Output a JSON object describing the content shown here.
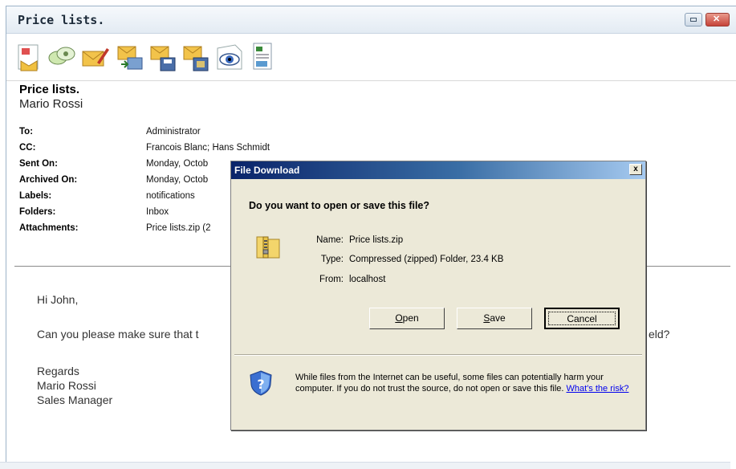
{
  "window": {
    "title": "Price lists."
  },
  "toolbar": {
    "buttons": [
      "reply-icon",
      "forward-discussion-icon",
      "compose-icon",
      "export-icon",
      "save-email-icon",
      "save-attachments-icon",
      "preview-icon",
      "view-details-icon"
    ]
  },
  "email": {
    "subject": "Price lists.",
    "sender": "Mario Rossi",
    "fields": [
      {
        "label": "To:",
        "value": "Administrator"
      },
      {
        "label": "CC:",
        "value": "Francois Blanc; Hans Schmidt"
      },
      {
        "label": "Sent On:",
        "value": "Monday, Octob"
      },
      {
        "label": "Archived On:",
        "value": "Monday, Octob"
      },
      {
        "label": "Labels:",
        "value": "notifications"
      },
      {
        "label": "Folders:",
        "value": "Inbox"
      },
      {
        "label": "Attachments:",
        "value": "Price lists.zip (2"
      }
    ],
    "body": {
      "greeting": "Hi John,",
      "line1_left": "Can you please make sure that t",
      "line1_right": "eld?",
      "regards": "Regards",
      "sig_name": "Mario Rossi",
      "sig_title": "Sales Manager"
    }
  },
  "dialog": {
    "title": "File Download",
    "close": "x",
    "question": "Do you want to open or save this file?",
    "name_label": "Name:",
    "name_value": "Price lists.zip",
    "type_label": "Type:",
    "type_value": "Compressed (zipped) Folder, 23.4 KB",
    "from_label": "From:",
    "from_value": "localhost",
    "open_mnemonic": "O",
    "open_rest": "pen",
    "save_mnemonic": "S",
    "save_rest": "ave",
    "cancel": "Cancel",
    "warning": "While files from the Internet can be useful, some files can potentially harm your computer. If you do not trust the source, do not open or save this file.",
    "risk_link": "What's the risk?"
  }
}
